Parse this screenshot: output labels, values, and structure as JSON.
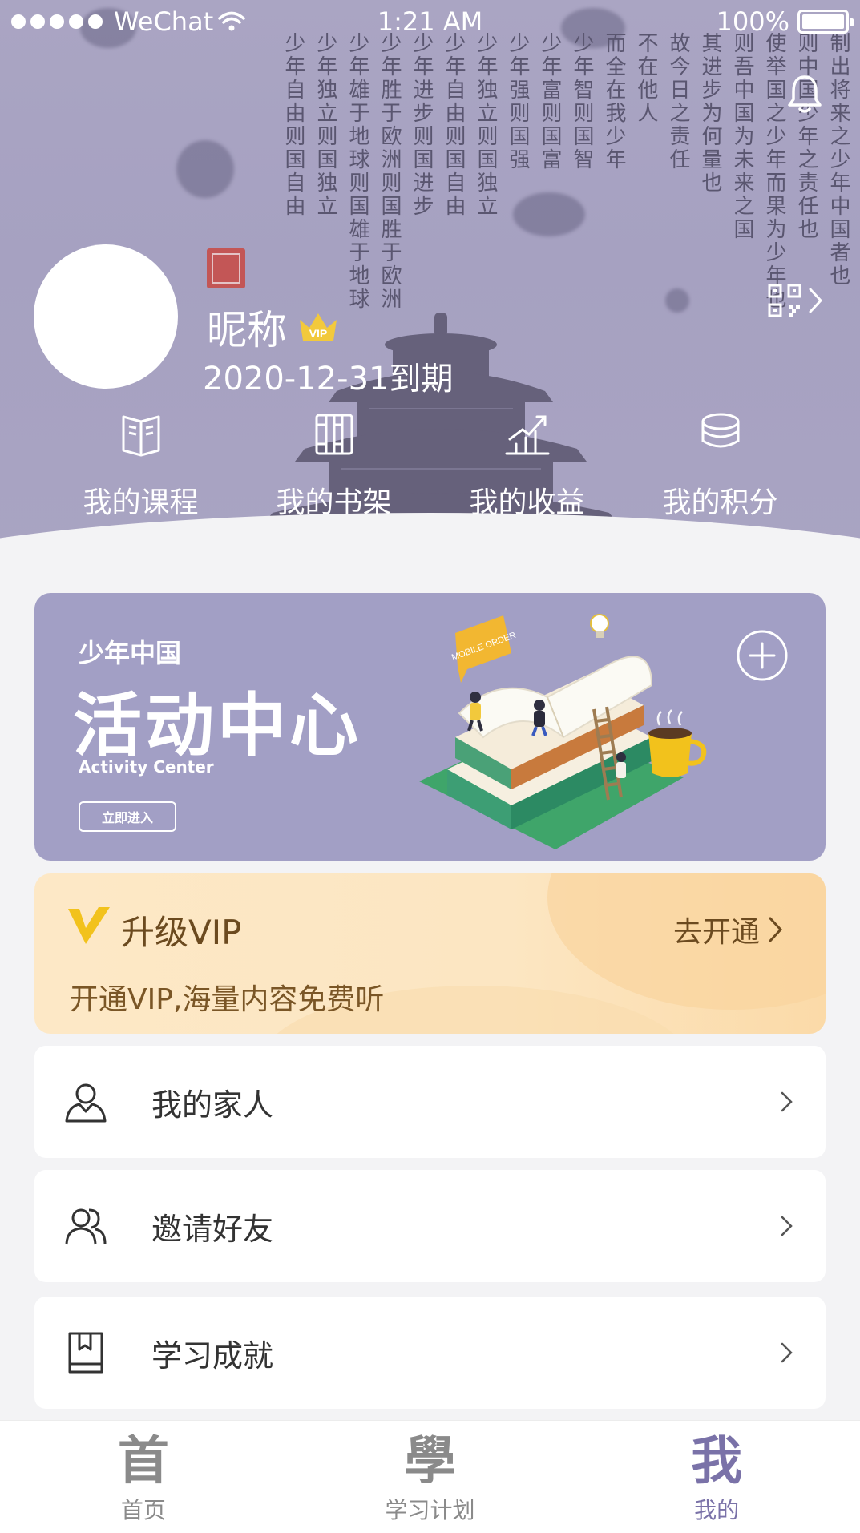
{
  "status_bar": {
    "carrier": "WeChat",
    "time": "1:21 AM",
    "battery": "100%"
  },
  "poem": {
    "columns": [
      "制出将来之少年中国者也",
      "则中国少年之责任也",
      "使举国之少年而果为少年也",
      "则吾中国为未来之国",
      "其进步为何量也",
      "故今日之责任",
      "不在他人",
      "而全在我少年",
      "少年智则国智",
      "少年富则国富",
      "少年强则国强",
      "少年独立则国独立",
      "少年自由则国自由",
      "少年进步则国进步",
      "少年胜于欧洲则国胜于欧洲",
      "少年雄于地球则国雄于地球",
      "少年独立则国独立",
      "少年自由则国自由"
    ]
  },
  "profile": {
    "nickname": "昵称",
    "vip_badge": "VIP",
    "expire": "2020-12-31到期"
  },
  "quick_actions": [
    {
      "label": "我的课程",
      "icon": "open-book-icon"
    },
    {
      "label": "我的书架",
      "icon": "bookshelf-icon"
    },
    {
      "label": "我的收益",
      "icon": "chart-growth-icon"
    },
    {
      "label": "我的积分",
      "icon": "coins-stack-icon"
    }
  ],
  "activity": {
    "subtitle": "少年中国",
    "title": "活动中心",
    "english": "Activity Center",
    "button": "立即进入",
    "sign_text": "MOBILE ORDER"
  },
  "vip": {
    "title": "升级VIP",
    "description": "开通VIP,海量内容免费听",
    "action": "去开通"
  },
  "menu": [
    {
      "label": "我的家人",
      "icon": "person-icon"
    },
    {
      "label": "邀请好友",
      "icon": "people-icon"
    },
    {
      "label": "学习成就",
      "icon": "bookmark-book-icon"
    }
  ],
  "tabs": [
    {
      "glyph": "首",
      "label": "首页",
      "active": false
    },
    {
      "glyph": "學",
      "label": "学习计划",
      "active": false
    },
    {
      "glyph": "我",
      "label": "我的",
      "active": true
    }
  ],
  "colors": {
    "header_purple": "#a6a1c1",
    "banner_purple": "#a29fc5",
    "vip_gold": "#f2c93c",
    "vip_text": "#6b4a1f",
    "tab_active": "#7a72a8",
    "tab_inactive": "#8a8a8a"
  }
}
